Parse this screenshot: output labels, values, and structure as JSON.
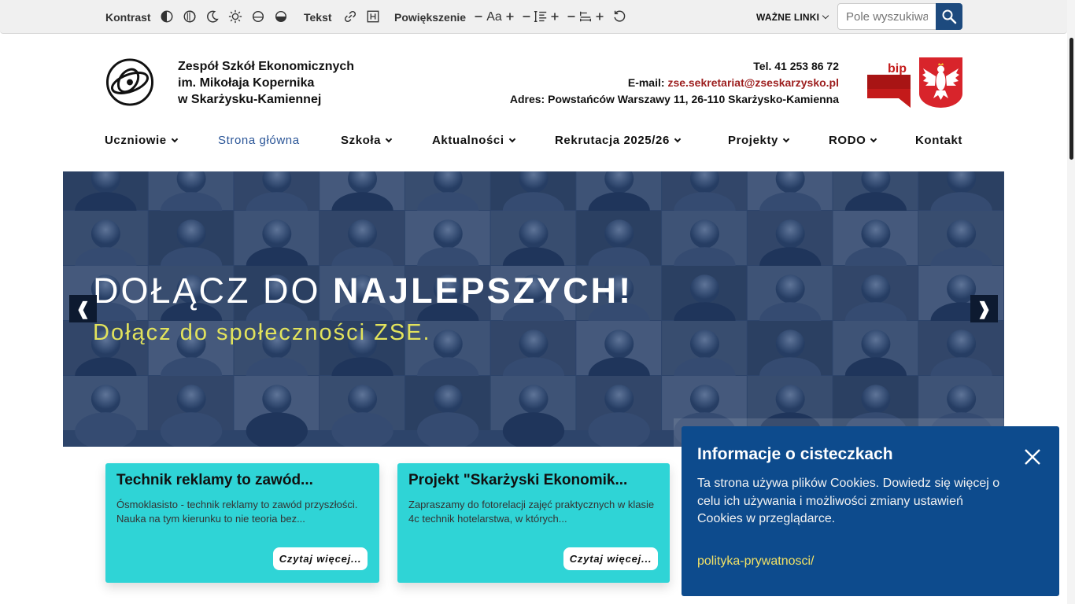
{
  "toolbar": {
    "contrast_label": "Kontrast",
    "text_label": "Tekst",
    "zoom_label": "Powiększenie",
    "font_size_icon_text": "Aa",
    "important_links": "WAŻNE LINKI",
    "search_placeholder": "Pole wyszukiwania",
    "icons": [
      "contrast-icon",
      "invert-icon",
      "night-mode-icon",
      "brightness-icon",
      "grayscale-icon",
      "saturation-icon",
      "link-highlight-icon",
      "heading-highlight-icon",
      "font-decrease-icon",
      "font-size-icon",
      "font-increase-icon",
      "line-height-decrease-icon",
      "line-height-icon",
      "line-height-increase-icon",
      "letter-spacing-decrease-icon",
      "letter-spacing-icon",
      "letter-spacing-increase-icon",
      "reset-icon",
      "search-icon"
    ],
    "search_button_color": "#1d4a7e"
  },
  "header": {
    "school_line1": "Zespół Szkół Ekonomicznych",
    "school_line2": "im. Mikołaja Kopernika",
    "school_line3": "w Skarżysku-Kamiennej",
    "tel_label": "Tel.",
    "tel_value": "41 253 86 72",
    "email_label": "E-mail:",
    "email_value": "zse.sekretariat@zseskarzysko.pl",
    "address_label": "Adres:",
    "address_value": "Powstańców Warszawy 11, 26-110 Skarżysko-Kamienna",
    "bip_text": "bip",
    "email_color": "#9c1d1d"
  },
  "nav": {
    "items": [
      {
        "label": "Uczniowie",
        "dropdown": true
      },
      {
        "label": "Strona główna",
        "dropdown": false,
        "active": true
      },
      {
        "label": "Szkoła",
        "dropdown": true
      },
      {
        "label": "Aktualności",
        "dropdown": true
      },
      {
        "label": "Rekrutacja 2025/26",
        "dropdown": true
      },
      {
        "label": "Projekty",
        "dropdown": true
      },
      {
        "label": "RODO",
        "dropdown": true
      },
      {
        "label": "Kontakt",
        "dropdown": false
      }
    ],
    "active_color": "#2a5597"
  },
  "hero": {
    "title_normal": "DOŁĄCZ DO ",
    "title_bold": "NAJLEPSZYCH!",
    "subtitle": "Dołącz do społeczności ZSE.",
    "prev_arrow": "❰",
    "next_arrow": "❱",
    "subtitle_color": "#e2e35c"
  },
  "cards": [
    {
      "title": "Technik reklamy to zawód...",
      "description": "Ósmoklasisto - technik reklamy to zawód przyszłości. Nauka na tym kierunku to nie teoria bez...",
      "button": "Czytaj więcej..."
    },
    {
      "title": "Projekt \"Skarżyski Ekonomik...",
      "description": "Zapraszamy do fotorelacji zajęć praktycznych w klasie 4c technik hotelarstwa, w których...",
      "button": "Czytaj więcej..."
    }
  ],
  "card_color": "#2fd4d6",
  "cookie": {
    "title": "Informacje o cisteczkach",
    "text": "Ta strona używa plików Cookies. Dowiedz się więcej o celu ich używania i możliwości zmiany ustawień Cookies w przeglądarce.",
    "link": "polityka-prywatnosci/",
    "background": "#0d4b8d",
    "link_color": "#f0e066"
  }
}
